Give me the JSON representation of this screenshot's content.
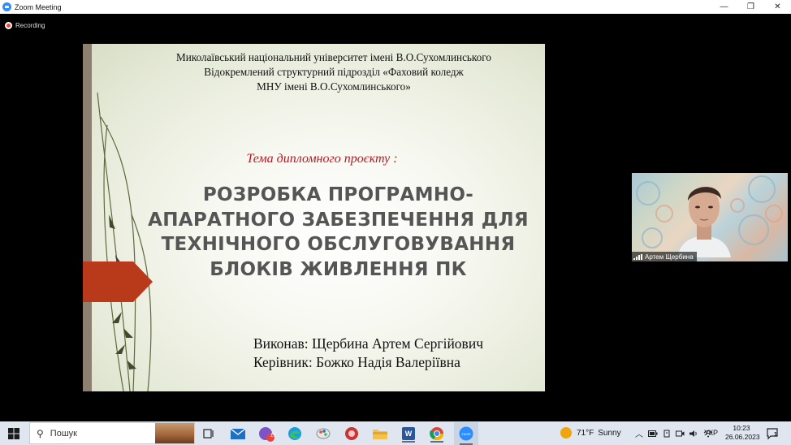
{
  "window": {
    "title": "Zoom Meeting",
    "minimize_glyph": "—",
    "restore_glyph": "❐",
    "close_glyph": "✕"
  },
  "recording": {
    "label": "Recording",
    "color": "#e8453c"
  },
  "slide": {
    "institution_lines": [
      "Миколаївський національний університет імені В.О.Сухомлинського",
      "Відокремлений структурний підрозділ «Фаховий коледж",
      "МНУ імені В.О.Сухомлинського»"
    ],
    "theme_label": "Тема дипломного проєкту :",
    "project_title_lines": [
      "РОЗРОБКА ПРОГРАМНО-",
      "АПАРАТНОГО ЗАБЕЗПЕЧЕННЯ ДЛЯ",
      "ТЕХНІЧНОГО ОБСЛУГОВУВАННЯ",
      "БЛОКІВ ЖИВЛЕННЯ ПК"
    ],
    "author_line": "Виконав: Щербина Артем Сергійович",
    "supervisor_line": "Керівник: Божко Надія Валеріївна",
    "accent_color": "#c0141e",
    "arrow_color": "#b83a1a"
  },
  "participant": {
    "name": "Артем Щербина"
  },
  "taskbar": {
    "search_placeholder": "Пошук",
    "mail_badge": "",
    "viber_badge": "17",
    "weather_temp": "71°F",
    "weather_condition": "Sunny",
    "language": "УКР",
    "time": "10:23",
    "date": "26.06.2023",
    "notification_count": "1",
    "zoom_label": "zoom",
    "word_letter": "W"
  }
}
